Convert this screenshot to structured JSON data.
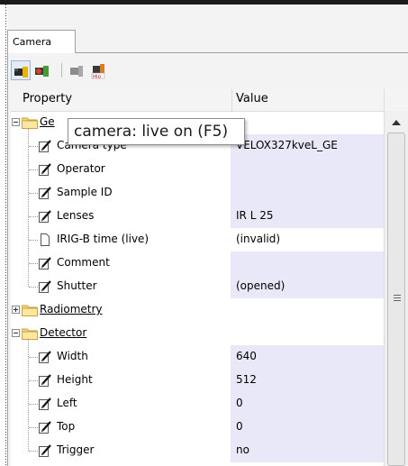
{
  "tab": {
    "label": "Camera"
  },
  "toolbar": {
    "buttons": [
      {
        "icon": "camera-live-icon",
        "active": true
      },
      {
        "icon": "camera-record-icon",
        "active": false
      },
      {
        "icon": "camera-snapshot-icon",
        "active": false
      },
      {
        "icon": "camera-nuc-icon",
        "badge": "Hlo"
      }
    ]
  },
  "grid": {
    "columns": [
      "Property",
      "Value"
    ],
    "groups": [
      {
        "label": "General",
        "label_visible": "Ge",
        "expanded": true,
        "rows": [
          {
            "label": "Camera type",
            "value": "VELOX327kveL_GE",
            "editable": true
          },
          {
            "label": "Operator",
            "value": "",
            "editable": true
          },
          {
            "label": "Sample ID",
            "value": "",
            "editable": true
          },
          {
            "label": "Lenses",
            "value": "IR L 25",
            "editable": true
          },
          {
            "label": "IRIG-B time (live)",
            "value": "(invalid)",
            "editable": false
          },
          {
            "label": "Comment",
            "value": "",
            "editable": true
          },
          {
            "label": "Shutter",
            "value": "(opened)",
            "editable": true
          }
        ]
      },
      {
        "label": "Radiometry",
        "expanded": false,
        "rows": []
      },
      {
        "label": "Detector",
        "expanded": true,
        "rows": [
          {
            "label": "Width",
            "value": "640",
            "editable": true
          },
          {
            "label": "Height",
            "value": "512",
            "editable": true
          },
          {
            "label": "Left",
            "value": "0",
            "editable": true
          },
          {
            "label": "Top",
            "value": "0",
            "editable": true
          },
          {
            "label": "Trigger",
            "value": "no",
            "editable": true
          }
        ]
      }
    ]
  },
  "tooltip": {
    "text": "camera: live on (F5)"
  },
  "colors": {
    "value_shade": "#e8e8f8",
    "folder": "#f5d77a",
    "accent": "#3b78c4"
  }
}
